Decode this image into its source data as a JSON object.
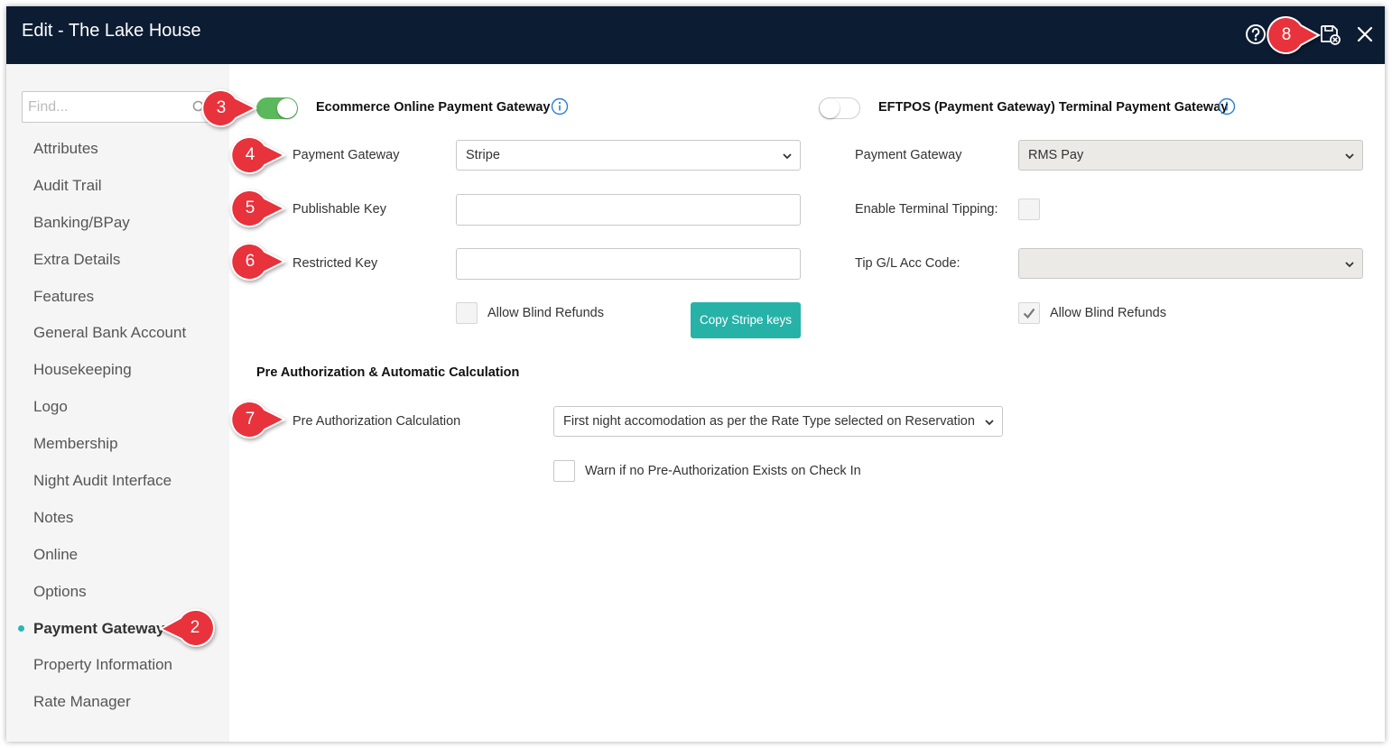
{
  "window": {
    "title": "Edit - The Lake House"
  },
  "sidebar": {
    "search_placeholder": "Find...",
    "items": [
      {
        "label": "Attributes"
      },
      {
        "label": "Audit Trail"
      },
      {
        "label": "Banking/BPay"
      },
      {
        "label": "Extra Details"
      },
      {
        "label": "Features"
      },
      {
        "label": "General Bank Account"
      },
      {
        "label": "Housekeeping"
      },
      {
        "label": "Logo"
      },
      {
        "label": "Membership"
      },
      {
        "label": "Night Audit Interface"
      },
      {
        "label": "Notes"
      },
      {
        "label": "Online"
      },
      {
        "label": "Options"
      },
      {
        "label": "Payment Gateway",
        "active": true
      },
      {
        "label": "Property Information"
      },
      {
        "label": "Rate Manager"
      }
    ]
  },
  "ecommerce": {
    "heading": "Ecommerce Online Payment Gateway",
    "enabled": true,
    "payment_gateway_label": "Payment Gateway",
    "payment_gateway_value": "Stripe",
    "publishable_key_label": "Publishable Key",
    "publishable_key_value": "",
    "restricted_key_label": "Restricted Key",
    "restricted_key_value": "",
    "allow_blind_refunds_label": "Allow Blind Refunds",
    "allow_blind_refunds_checked": false,
    "copy_button_label": "Copy Stripe keys"
  },
  "eftpos": {
    "heading": "EFTPOS (Payment Gateway) Terminal Payment Gateway",
    "enabled": false,
    "payment_gateway_label": "Payment Gateway",
    "payment_gateway_value": "RMS Pay",
    "tipping_label": "Enable Terminal Tipping:",
    "tipping_checked": false,
    "tip_code_label": "Tip G/L Acc Code:",
    "tip_code_value": "",
    "allow_blind_refunds_label": "Allow Blind Refunds",
    "allow_blind_refunds_checked": true
  },
  "preauth": {
    "section_title": "Pre Authorization & Automatic Calculation",
    "calc_label": "Pre Authorization Calculation",
    "calc_value": "First night accomodation as per the Rate Type selected on Reservation",
    "warn_label": "Warn if no Pre-Authorization Exists on Check In",
    "warn_checked": false
  },
  "callouts": [
    "2",
    "3",
    "4",
    "5",
    "6",
    "7",
    "8"
  ],
  "colors": {
    "titlebar": "#0c1c33",
    "callout": "#e8323c",
    "toggle_on": "#5cb85c",
    "accent": "#27b2a8",
    "info": "#2a7fd4"
  }
}
